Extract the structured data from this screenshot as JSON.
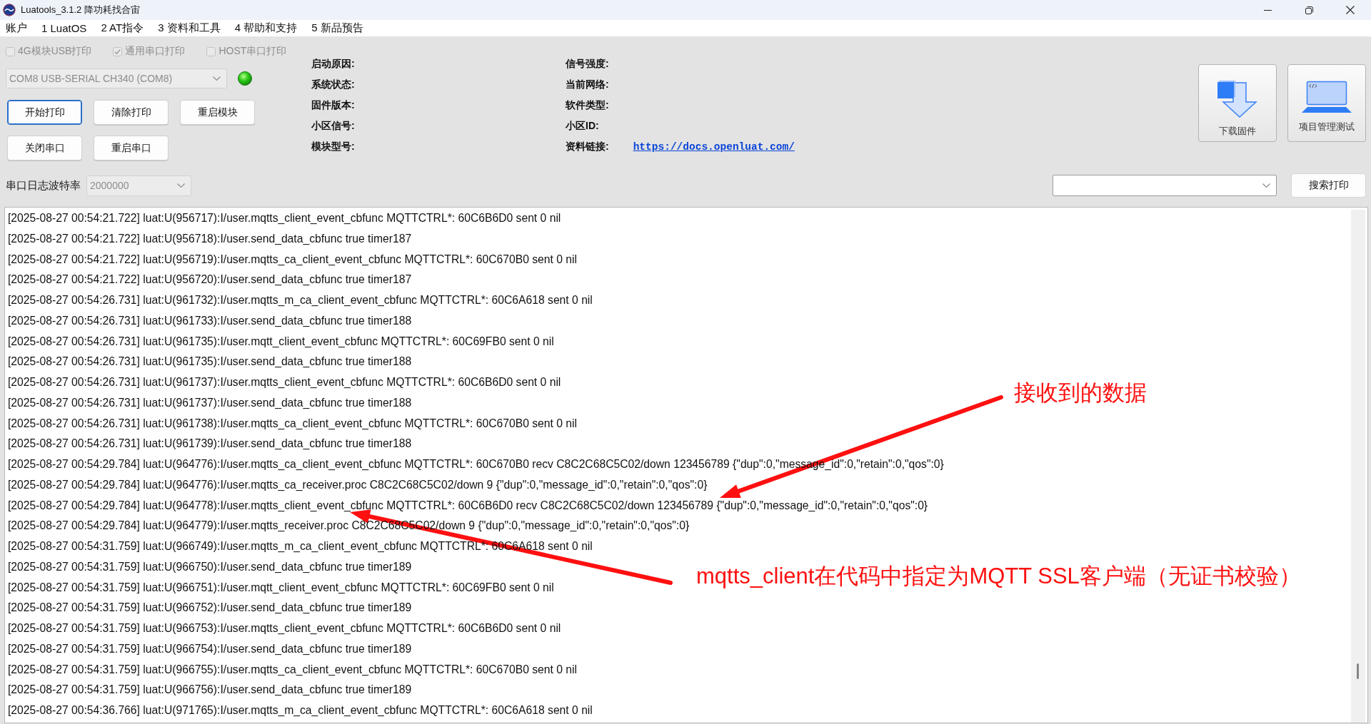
{
  "window": {
    "title": "Luatools_3.1.2 降功耗找合宙"
  },
  "menu": [
    "账户",
    "1 LuatOS",
    "2 AT指令",
    "3 资料和工具",
    "4 帮助和支持",
    "5 新品预告"
  ],
  "print_options": [
    {
      "label": "4G模块USB打印",
      "checked": false,
      "disabled": true
    },
    {
      "label": "通用串口打印",
      "checked": true,
      "disabled": true
    },
    {
      "label": "HOST串口打印",
      "checked": false,
      "disabled": true
    }
  ],
  "port_select": {
    "value": "COM8 USB-SERIAL CH340 (COM8)",
    "disabled": true
  },
  "status_led": {
    "on": true
  },
  "buttons": [
    {
      "label": "开始打印",
      "focused": true
    },
    {
      "label": "清除打印",
      "focused": false
    },
    {
      "label": "重启模块",
      "focused": false
    },
    {
      "label": "关闭串口",
      "focused": false
    },
    {
      "label": "重启串口",
      "focused": false
    }
  ],
  "device_info": [
    {
      "label": "启动原因:"
    },
    {
      "label": "信号强度:"
    },
    {
      "label": "系统状态:"
    },
    {
      "label": "当前网络:"
    },
    {
      "label": "固件版本:"
    },
    {
      "label": "软件类型:"
    },
    {
      "label": "小区信号:"
    },
    {
      "label": "小区ID:"
    },
    {
      "label": "模块型号:"
    },
    {
      "label": "资料链接:",
      "link": "https://docs.openluat.com/"
    }
  ],
  "tool_buttons": [
    {
      "label": "下载固件",
      "kind": "download"
    },
    {
      "label": "项目管理测试",
      "kind": "laptop"
    }
  ],
  "baud_rate": {
    "label": "串口日志波特率",
    "value": "2000000",
    "disabled": true
  },
  "search": {
    "button": "搜索打印"
  },
  "log": {
    "lines": [
      "[2025-08-27 00:54:21.722] luat:U(956717):I/user.mqtts_client_event_cbfunc MQTTCTRL*: 60C6B6D0 sent 0 nil",
      "[2025-08-27 00:54:21.722] luat:U(956718):I/user.send_data_cbfunc true timer187",
      "[2025-08-27 00:54:21.722] luat:U(956719):I/user.mqtts_ca_client_event_cbfunc MQTTCTRL*: 60C670B0 sent 0 nil",
      "[2025-08-27 00:54:21.722] luat:U(956720):I/user.send_data_cbfunc true timer187",
      "[2025-08-27 00:54:26.731] luat:U(961732):I/user.mqtts_m_ca_client_event_cbfunc MQTTCTRL*: 60C6A618 sent 0 nil",
      "[2025-08-27 00:54:26.731] luat:U(961733):I/user.send_data_cbfunc true timer188",
      "[2025-08-27 00:54:26.731] luat:U(961735):I/user.mqtt_client_event_cbfunc MQTTCTRL*: 60C69FB0 sent 0 nil",
      "[2025-08-27 00:54:26.731] luat:U(961735):I/user.send_data_cbfunc true timer188",
      "[2025-08-27 00:54:26.731] luat:U(961737):I/user.mqtts_client_event_cbfunc MQTTCTRL*: 60C6B6D0 sent 0 nil",
      "[2025-08-27 00:54:26.731] luat:U(961737):I/user.send_data_cbfunc true timer188",
      "[2025-08-27 00:54:26.731] luat:U(961738):I/user.mqtts_ca_client_event_cbfunc MQTTCTRL*: 60C670B0 sent 0 nil",
      "[2025-08-27 00:54:26.731] luat:U(961739):I/user.send_data_cbfunc true timer188",
      "[2025-08-27 00:54:29.784] luat:U(964776):I/user.mqtts_ca_client_event_cbfunc MQTTCTRL*: 60C670B0 recv C8C2C68C5C02/down 123456789 {\"dup\":0,\"message_id\":0,\"retain\":0,\"qos\":0}",
      "[2025-08-27 00:54:29.784] luat:U(964776):I/user.mqtts_ca_receiver.proc C8C2C68C5C02/down 9 {\"dup\":0,\"message_id\":0,\"retain\":0,\"qos\":0}",
      "[2025-08-27 00:54:29.784] luat:U(964778):I/user.mqtts_client_event_cbfunc MQTTCTRL*: 60C6B6D0 recv C8C2C68C5C02/down 123456789 {\"dup\":0,\"message_id\":0,\"retain\":0,\"qos\":0}",
      "[2025-08-27 00:54:29.784] luat:U(964779):I/user.mqtts_receiver.proc C8C2C68C5C02/down 9 {\"dup\":0,\"message_id\":0,\"retain\":0,\"qos\":0}",
      "[2025-08-27 00:54:31.759] luat:U(966749):I/user.mqtts_m_ca_client_event_cbfunc MQTTCTRL*: 60C6A618 sent 0 nil",
      "[2025-08-27 00:54:31.759] luat:U(966750):I/user.send_data_cbfunc true timer189",
      "[2025-08-27 00:54:31.759] luat:U(966751):I/user.mqtt_client_event_cbfunc MQTTCTRL*: 60C69FB0 sent 0 nil",
      "[2025-08-27 00:54:31.759] luat:U(966752):I/user.send_data_cbfunc true timer189",
      "[2025-08-27 00:54:31.759] luat:U(966753):I/user.mqtts_client_event_cbfunc MQTTCTRL*: 60C6B6D0 sent 0 nil",
      "[2025-08-27 00:54:31.759] luat:U(966754):I/user.send_data_cbfunc true timer189",
      "[2025-08-27 00:54:31.759] luat:U(966755):I/user.mqtts_ca_client_event_cbfunc MQTTCTRL*: 60C670B0 sent 0 nil",
      "[2025-08-27 00:54:31.759] luat:U(966756):I/user.send_data_cbfunc true timer189",
      "[2025-08-27 00:54:36.766] luat:U(971765):I/user.mqtts_m_ca_client_event_cbfunc MQTTCTRL*: 60C6A618 sent 0 nil"
    ]
  },
  "annotations": [
    {
      "text": "接收到的数据"
    },
    {
      "text": "mqtts_client在代码中指定为MQTT SSL客户端（无证书校验）"
    }
  ]
}
